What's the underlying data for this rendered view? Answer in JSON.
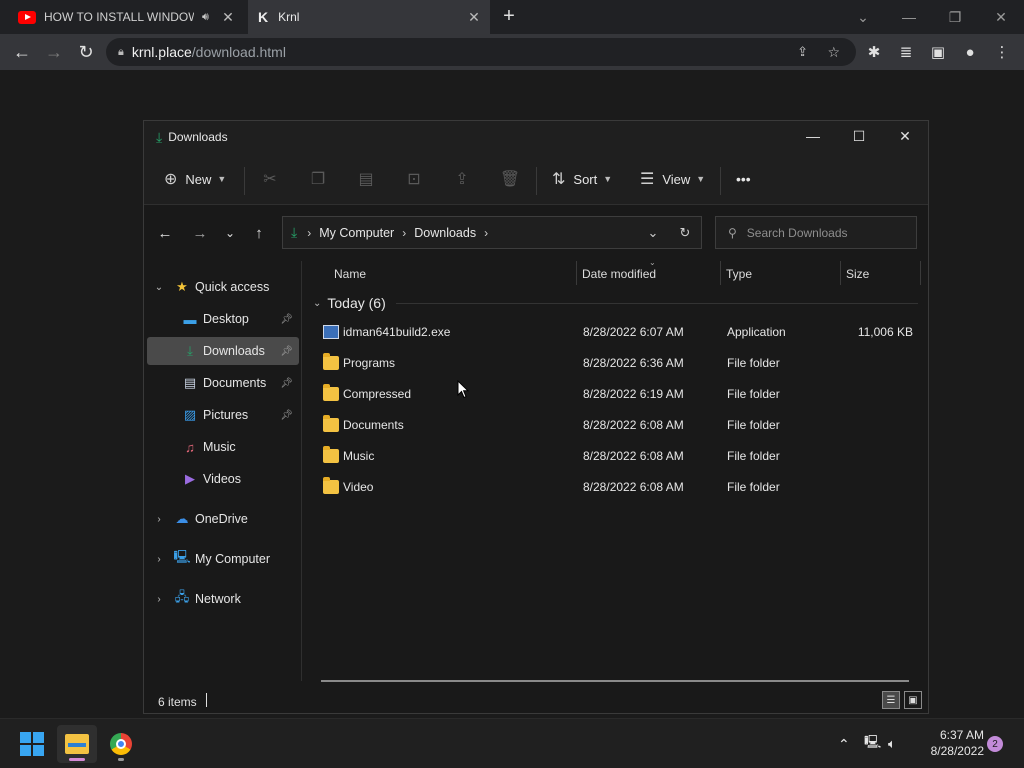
{
  "browser": {
    "tabs": [
      {
        "title": "HOW TO INSTALL WINDOWS",
        "favicon": "youtube-icon",
        "audio": "speaker-icon"
      },
      {
        "title": "Krnl",
        "favicon": "krnl-icon"
      }
    ],
    "new_tab": "+",
    "url_host": "krnl.place",
    "url_path": "/download.html"
  },
  "explorer": {
    "title": "Downloads",
    "commands": {
      "new_label": "New",
      "sort_label": "Sort",
      "view_label": "View",
      "more_label": "•••"
    },
    "breadcrumb": [
      "My Computer",
      "Downloads"
    ],
    "search_placeholder": "Search Downloads",
    "nav": {
      "quick_access": "Quick access",
      "pinned": [
        "Desktop",
        "Downloads",
        "Documents",
        "Pictures"
      ],
      "unpinned": [
        "Music",
        "Videos"
      ],
      "onedrive": "OneDrive",
      "my_computer": "My Computer",
      "network": "Network"
    },
    "columns": [
      "Name",
      "Date modified",
      "Type",
      "Size"
    ],
    "group": "Today (6)",
    "files": [
      {
        "name": "idman641build2.exe",
        "date": "8/28/2022 6:07 AM",
        "type": "Application",
        "size": "11,006 KB",
        "icon": "exe-icon"
      },
      {
        "name": "Programs",
        "date": "8/28/2022 6:36 AM",
        "type": "File folder",
        "size": "",
        "icon": "folder-icon"
      },
      {
        "name": "Compressed",
        "date": "8/28/2022 6:19 AM",
        "type": "File folder",
        "size": "",
        "icon": "folder-icon"
      },
      {
        "name": "Documents",
        "date": "8/28/2022 6:08 AM",
        "type": "File folder",
        "size": "",
        "icon": "folder-icon"
      },
      {
        "name": "Music",
        "date": "8/28/2022 6:08 AM",
        "type": "File folder",
        "size": "",
        "icon": "folder-icon"
      },
      {
        "name": "Video",
        "date": "8/28/2022 6:08 AM",
        "type": "File folder",
        "size": "",
        "icon": "folder-icon"
      }
    ],
    "status": "6 items"
  },
  "taskbar": {
    "time": "6:37 AM",
    "date": "8/28/2022",
    "notifications": "2"
  },
  "colors": {
    "accent_green": "#26a269",
    "folder_yellow": "#f3c242",
    "selection": "#4a4a4a"
  }
}
